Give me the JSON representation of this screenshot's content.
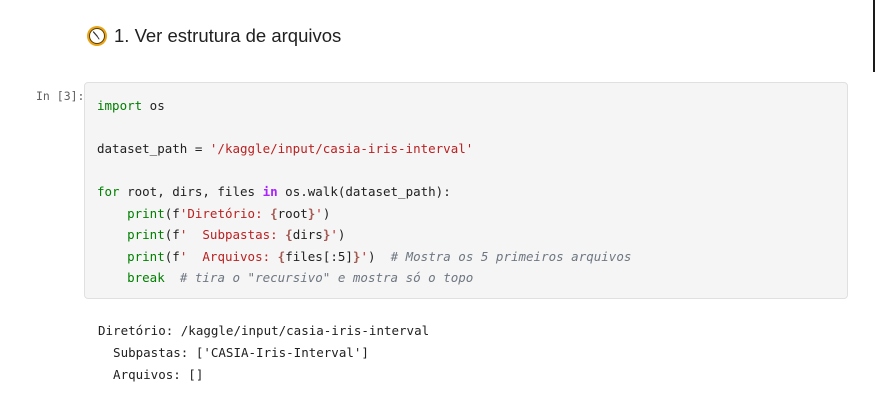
{
  "heading": {
    "icon": "stopwatch-icon",
    "text": "1. Ver estrutura de arquivos"
  },
  "cell": {
    "prompt": "In [3]:",
    "code_lines": [
      "import os",
      "",
      "dataset_path = '/kaggle/input/casia-iris-interval'",
      "",
      "for root, dirs, files in os.walk(dataset_path):",
      "    print(f'Diretório: {root}')",
      "    print(f'  Subpastas: {dirs}')",
      "    print(f'  Arquivos: {files[:5]}')  # Mostra os 5 primeiros arquivos",
      "    break  # tira o \"recursivo\" e mostra só o topo"
    ]
  },
  "output": {
    "lines": [
      "Diretório: /kaggle/input/casia-iris-interval",
      "  Subpastas: ['CASIA-Iris-Interval']",
      "  Arquivos: []"
    ]
  },
  "colors": {
    "keyword": "#008000",
    "operator_keyword": "#aa22ff",
    "string": "#ba2121",
    "comment": "#6e7781",
    "cell_background": "#f5f5f5"
  }
}
